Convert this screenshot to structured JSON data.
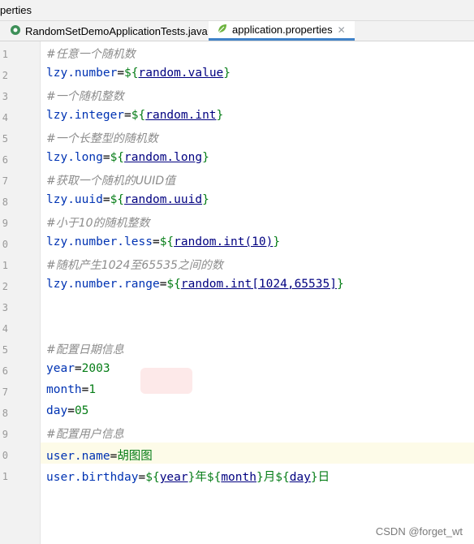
{
  "breadcrumb": "perties",
  "tabs": [
    {
      "label": "RandomSetDemoApplicationTests.java",
      "active": false,
      "icon": "java-test-icon"
    },
    {
      "label": "application.properties",
      "active": true,
      "icon": "spring-leaf-icon"
    }
  ],
  "lines": [
    {
      "n": "1",
      "comment": "#任意一个随机数"
    },
    {
      "n": "2",
      "key": "lzy.number",
      "ref": "random.value"
    },
    {
      "n": "3",
      "comment": "#一个随机整数"
    },
    {
      "n": "4",
      "key": "lzy.integer",
      "ref": "random.int"
    },
    {
      "n": "5",
      "comment": "#一个长整型的随机数"
    },
    {
      "n": "6",
      "key": "lzy.long",
      "ref": "random.long"
    },
    {
      "n": "7",
      "comment": "#获取一个随机的UUID值"
    },
    {
      "n": "8",
      "key": "lzy.uuid",
      "ref": "random.uuid"
    },
    {
      "n": "9",
      "comment": "#小于10的随机整数"
    },
    {
      "n": "0",
      "key": "lzy.number.less",
      "ref": "random.int(10)"
    },
    {
      "n": "1",
      "comment": "#随机产生1024至65535之间的数"
    },
    {
      "n": "2",
      "key": "lzy.number.range",
      "ref": "random.int[1024,65535]"
    },
    {
      "n": "3"
    },
    {
      "n": "4"
    },
    {
      "n": "5",
      "comment": "#配置日期信息"
    },
    {
      "n": "6",
      "key": "year",
      "value": "2003"
    },
    {
      "n": "7",
      "key": "month",
      "value": "1"
    },
    {
      "n": "8",
      "key": "day",
      "value": "05"
    },
    {
      "n": "9",
      "comment": "#配置用户信息"
    },
    {
      "n": "0",
      "key": "user.name",
      "value": "胡图图"
    },
    {
      "n": "1",
      "key": "user.birthday",
      "birthday": true
    }
  ],
  "birthday_parts": {
    "ref1": "year",
    "t1": "年",
    "ref2": "month",
    "t2": "月",
    "ref3": "day",
    "t3": "日"
  },
  "watermark": "CSDN @forget_wt",
  "colors": {
    "accent_tab": "#4083c9",
    "comment": "#8c8c8c",
    "key": "#0033b3",
    "value": "#067d17",
    "ref": "#000080",
    "current_line": "#fdfbe8"
  }
}
